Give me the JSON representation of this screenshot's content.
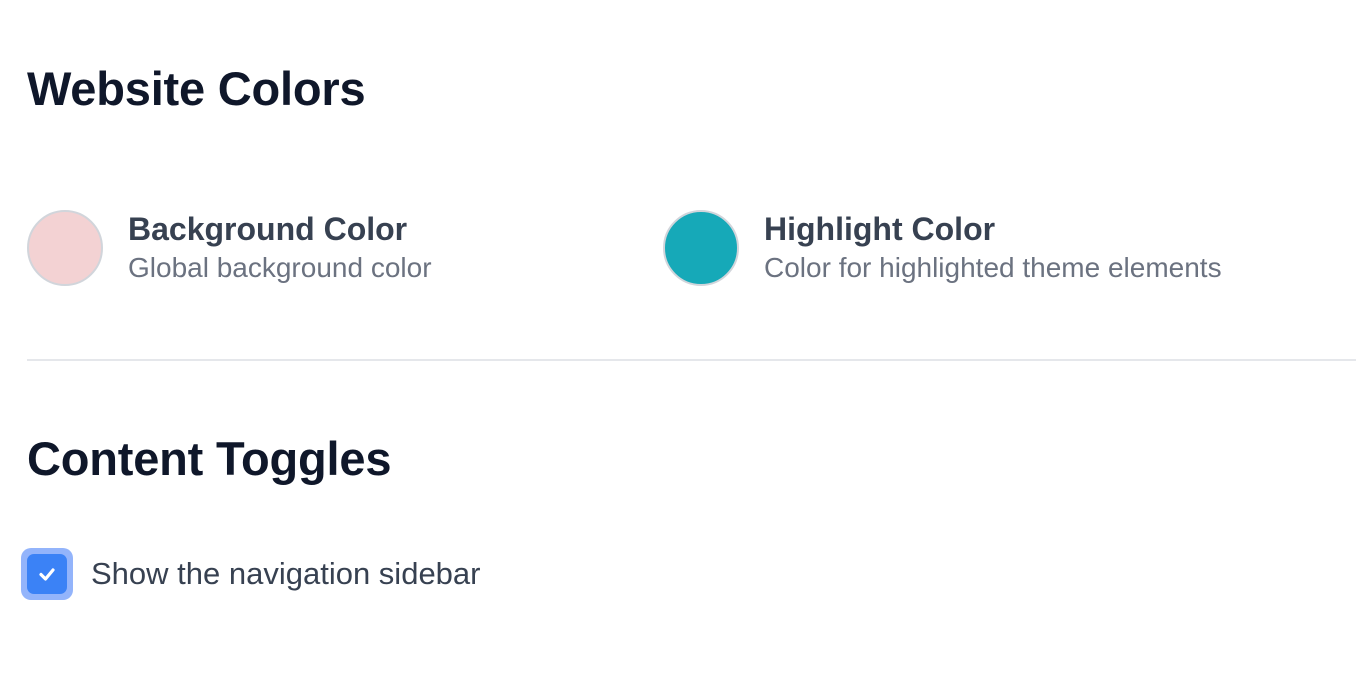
{
  "sections": {
    "colors": {
      "title": "Website Colors",
      "items": [
        {
          "label": "Background Color",
          "description": "Global background color",
          "color": "#f3d2d3"
        },
        {
          "label": "Highlight Color",
          "description": "Color for highlighted theme elements",
          "color": "#16a9b8"
        }
      ]
    },
    "toggles": {
      "title": "Content Toggles",
      "items": [
        {
          "label": "Show the navigation sidebar",
          "checked": true,
          "icon": "check-icon"
        }
      ]
    }
  },
  "theme": {
    "accent": "#3b82f6",
    "heading_color": "#0f172a",
    "label_color": "#374151",
    "muted_color": "#6b7280",
    "divider_color": "#e5e7eb"
  }
}
